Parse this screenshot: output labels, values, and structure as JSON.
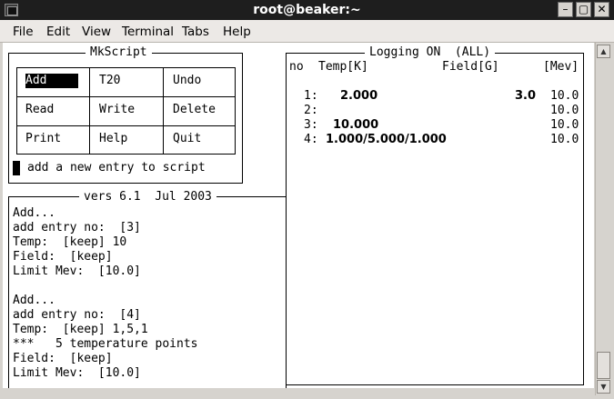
{
  "window": {
    "title": "root@beaker:~"
  },
  "titlebar_buttons": [
    {
      "icon": "minimize-icon",
      "glyph": "–"
    },
    {
      "icon": "maximize-icon",
      "glyph": "▢"
    },
    {
      "icon": "close-icon",
      "glyph": "✕"
    }
  ],
  "menu": [
    "File",
    "Edit",
    "View",
    "Terminal",
    "Tabs",
    "Help"
  ],
  "mkscript": {
    "title": "MkScript",
    "buttons": [
      [
        "Add",
        "T20",
        "Undo"
      ],
      [
        "Read",
        "Write",
        "Delete"
      ],
      [
        "Print",
        "Help",
        "Quit"
      ]
    ],
    "selected": "Add",
    "status": "add a new entry to script"
  },
  "log_panel": {
    "title": "vers 6.1  Jul 2003",
    "lines": [
      "Add...",
      "add entry no:  [3]",
      "Temp:  [keep] 10",
      "Field:  [keep]",
      "Limit Mev:  [10.0]",
      "",
      "Add...",
      "add entry no:  [4]",
      "Temp:  [keep] 1,5,1",
      "***   5 temperature points",
      "Field:  [keep]",
      "Limit Mev:  [10.0]"
    ]
  },
  "logging_panel": {
    "title": "Logging ON  (ALL)",
    "headers": {
      "no": "no",
      "temp": "Temp[K]",
      "field": "Field[G]",
      "mev": "[Mev]"
    },
    "rows": [
      {
        "no": "1:",
        "temp": "2.000",
        "field": "3.0",
        "mev": "10.0"
      },
      {
        "no": "2:",
        "temp": "",
        "field": "",
        "mev": "10.0"
      },
      {
        "no": "3:",
        "temp": "10.000",
        "field": "",
        "mev": "10.0"
      },
      {
        "no": "4:",
        "temp": "1.000/5.000/1.000",
        "field": "",
        "mev": "10.0"
      }
    ]
  }
}
